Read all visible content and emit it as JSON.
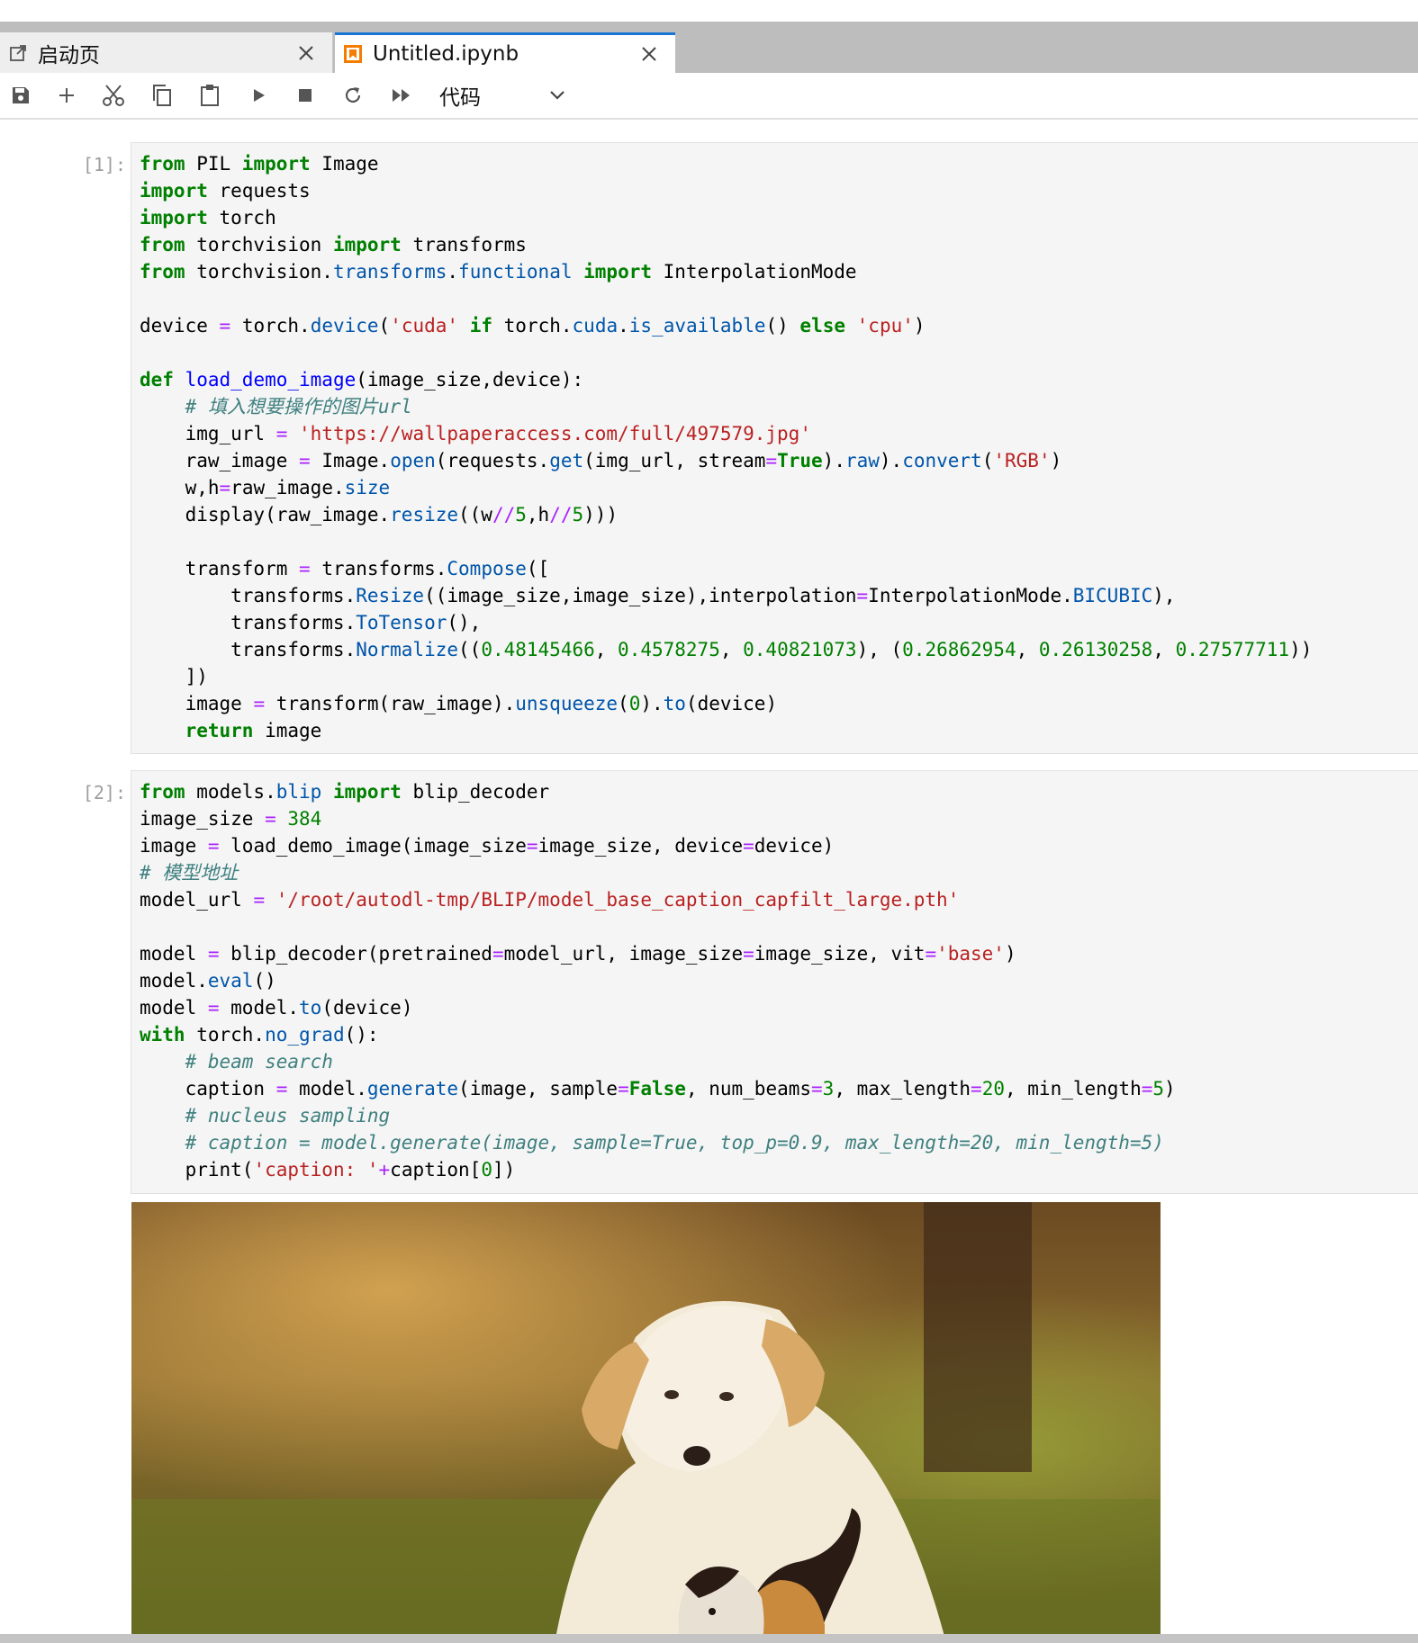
{
  "tabs": [
    {
      "label": "启动页",
      "icon": "launcher-icon",
      "active": false
    },
    {
      "label": "Untitled.ipynb",
      "icon": "notebook-icon",
      "active": true
    }
  ],
  "toolbar": {
    "buttons": [
      "save-icon",
      "add-icon",
      "cut-icon",
      "copy-icon",
      "paste-icon",
      "run-icon",
      "stop-icon",
      "restart-icon",
      "fast-forward-icon"
    ],
    "cell_type": "代码"
  },
  "cells": [
    {
      "prompt": "[1]:",
      "lines": [
        [
          [
            "kw",
            "from"
          ],
          [
            "t",
            " PIL "
          ],
          [
            "kw",
            "import"
          ],
          [
            "t",
            " Image"
          ]
        ],
        [
          [
            "kw",
            "import"
          ],
          [
            "t",
            " requests"
          ]
        ],
        [
          [
            "kw",
            "import"
          ],
          [
            "t",
            " torch"
          ]
        ],
        [
          [
            "kw",
            "from"
          ],
          [
            "t",
            " torchvision "
          ],
          [
            "kw",
            "import"
          ],
          [
            "t",
            " transforms"
          ]
        ],
        [
          [
            "kw",
            "from"
          ],
          [
            "t",
            " torchvision"
          ],
          [
            "t",
            "."
          ],
          [
            "p",
            "transforms"
          ],
          [
            "t",
            "."
          ],
          [
            "p",
            "functional"
          ],
          [
            "t",
            " "
          ],
          [
            "kw",
            "import"
          ],
          [
            "t",
            " InterpolationMode"
          ]
        ],
        [],
        [
          [
            "t",
            "device "
          ],
          [
            "o",
            "="
          ],
          [
            "t",
            " torch."
          ],
          [
            "p",
            "device"
          ],
          [
            "t",
            "("
          ],
          [
            "s",
            "'cuda'"
          ],
          [
            "t",
            " "
          ],
          [
            "kw",
            "if"
          ],
          [
            "t",
            " torch."
          ],
          [
            "p",
            "cuda"
          ],
          [
            "t",
            "."
          ],
          [
            "p",
            "is_available"
          ],
          [
            "t",
            "() "
          ],
          [
            "kw",
            "else"
          ],
          [
            "t",
            " "
          ],
          [
            "s",
            "'cpu'"
          ],
          [
            "t",
            ")"
          ]
        ],
        [],
        [
          [
            "kw",
            "def"
          ],
          [
            "t",
            " "
          ],
          [
            "f",
            "load_demo_image"
          ],
          [
            "t",
            "(image_size,device):"
          ]
        ],
        [
          [
            "t",
            "    "
          ],
          [
            "c",
            "# 填入想要操作的图片url"
          ]
        ],
        [
          [
            "t",
            "    img_url "
          ],
          [
            "o",
            "="
          ],
          [
            "t",
            " "
          ],
          [
            "s",
            "'https://wallpaperaccess.com/full/497579.jpg'"
          ]
        ],
        [
          [
            "t",
            "    raw_image "
          ],
          [
            "o",
            "="
          ],
          [
            "t",
            " Image."
          ],
          [
            "p",
            "open"
          ],
          [
            "t",
            "(requests."
          ],
          [
            "p",
            "get"
          ],
          [
            "t",
            "(img_url, stream"
          ],
          [
            "o",
            "="
          ],
          [
            "kw",
            "True"
          ],
          [
            "t",
            ")."
          ],
          [
            "p",
            "raw"
          ],
          [
            "t",
            ")."
          ],
          [
            "p",
            "convert"
          ],
          [
            "t",
            "("
          ],
          [
            "s",
            "'RGB'"
          ],
          [
            "t",
            ")"
          ]
        ],
        [
          [
            "t",
            "    w,h"
          ],
          [
            "o",
            "="
          ],
          [
            "t",
            "raw_image."
          ],
          [
            "p",
            "size"
          ]
        ],
        [
          [
            "t",
            "    display(raw_image."
          ],
          [
            "p",
            "resize"
          ],
          [
            "t",
            "((w"
          ],
          [
            "o",
            "//"
          ],
          [
            "n",
            "5"
          ],
          [
            "t",
            ",h"
          ],
          [
            "o",
            "//"
          ],
          [
            "n",
            "5"
          ],
          [
            "t",
            ")))"
          ]
        ],
        [],
        [
          [
            "t",
            "    transform "
          ],
          [
            "o",
            "="
          ],
          [
            "t",
            " transforms."
          ],
          [
            "p",
            "Compose"
          ],
          [
            "t",
            "(["
          ]
        ],
        [
          [
            "t",
            "        transforms."
          ],
          [
            "p",
            "Resize"
          ],
          [
            "t",
            "((image_size,image_size),interpolation"
          ],
          [
            "o",
            "="
          ],
          [
            "t",
            "InterpolationMode."
          ],
          [
            "p",
            "BICUBIC"
          ],
          [
            "t",
            "),"
          ]
        ],
        [
          [
            "t",
            "        transforms."
          ],
          [
            "p",
            "ToTensor"
          ],
          [
            "t",
            "(),"
          ]
        ],
        [
          [
            "t",
            "        transforms."
          ],
          [
            "p",
            "Normalize"
          ],
          [
            "t",
            "(("
          ],
          [
            "n",
            "0.48145466"
          ],
          [
            "t",
            ", "
          ],
          [
            "n",
            "0.4578275"
          ],
          [
            "t",
            ", "
          ],
          [
            "n",
            "0.40821073"
          ],
          [
            "t",
            "), ("
          ],
          [
            "n",
            "0.26862954"
          ],
          [
            "t",
            ", "
          ],
          [
            "n",
            "0.26130258"
          ],
          [
            "t",
            ", "
          ],
          [
            "n",
            "0.27577711"
          ],
          [
            "t",
            "))"
          ]
        ],
        [
          [
            "t",
            "    ])"
          ]
        ],
        [
          [
            "t",
            "    image "
          ],
          [
            "o",
            "="
          ],
          [
            "t",
            " transform(raw_image)."
          ],
          [
            "p",
            "unsqueeze"
          ],
          [
            "t",
            "("
          ],
          [
            "n",
            "0"
          ],
          [
            "t",
            ")."
          ],
          [
            "p",
            "to"
          ],
          [
            "t",
            "(device)"
          ]
        ],
        [
          [
            "t",
            "    "
          ],
          [
            "kw",
            "return"
          ],
          [
            "t",
            " image"
          ]
        ]
      ]
    },
    {
      "prompt": "[2]:",
      "lines": [
        [
          [
            "kw",
            "from"
          ],
          [
            "t",
            " models."
          ],
          [
            "p",
            "blip"
          ],
          [
            "t",
            " "
          ],
          [
            "kw",
            "import"
          ],
          [
            "t",
            " blip_decoder"
          ]
        ],
        [
          [
            "t",
            "image_size "
          ],
          [
            "o",
            "="
          ],
          [
            "t",
            " "
          ],
          [
            "n",
            "384"
          ]
        ],
        [
          [
            "t",
            "image "
          ],
          [
            "o",
            "="
          ],
          [
            "t",
            " load_demo_image(image_size"
          ],
          [
            "o",
            "="
          ],
          [
            "t",
            "image_size, device"
          ],
          [
            "o",
            "="
          ],
          [
            "t",
            "device)"
          ]
        ],
        [
          [
            "c",
            "# 模型地址"
          ]
        ],
        [
          [
            "t",
            "model_url "
          ],
          [
            "o",
            "="
          ],
          [
            "t",
            " "
          ],
          [
            "s",
            "'/root/autodl-tmp/BLIP/model_base_caption_capfilt_large.pth'"
          ]
        ],
        [],
        [
          [
            "t",
            "model "
          ],
          [
            "o",
            "="
          ],
          [
            "t",
            " blip_decoder(pretrained"
          ],
          [
            "o",
            "="
          ],
          [
            "t",
            "model_url, image_size"
          ],
          [
            "o",
            "="
          ],
          [
            "t",
            "image_size, vit"
          ],
          [
            "o",
            "="
          ],
          [
            "s",
            "'base'"
          ],
          [
            "t",
            ")"
          ]
        ],
        [
          [
            "t",
            "model."
          ],
          [
            "p",
            "eval"
          ],
          [
            "t",
            "()"
          ]
        ],
        [
          [
            "t",
            "model "
          ],
          [
            "o",
            "="
          ],
          [
            "t",
            " model."
          ],
          [
            "p",
            "to"
          ],
          [
            "t",
            "(device)"
          ]
        ],
        [
          [
            "kw",
            "with"
          ],
          [
            "t",
            " torch."
          ],
          [
            "p",
            "no_grad"
          ],
          [
            "t",
            "():"
          ]
        ],
        [
          [
            "t",
            "    "
          ],
          [
            "c",
            "# beam search"
          ]
        ],
        [
          [
            "t",
            "    caption "
          ],
          [
            "o",
            "="
          ],
          [
            "t",
            " model."
          ],
          [
            "p",
            "generate"
          ],
          [
            "t",
            "(image, sample"
          ],
          [
            "o",
            "="
          ],
          [
            "kw",
            "False"
          ],
          [
            "t",
            ", num_beams"
          ],
          [
            "o",
            "="
          ],
          [
            "n",
            "3"
          ],
          [
            "t",
            ", max_length"
          ],
          [
            "o",
            "="
          ],
          [
            "n",
            "20"
          ],
          [
            "t",
            ", min_length"
          ],
          [
            "o",
            "="
          ],
          [
            "n",
            "5"
          ],
          [
            "t",
            ")"
          ]
        ],
        [
          [
            "t",
            "    "
          ],
          [
            "c",
            "# nucleus sampling"
          ]
        ],
        [
          [
            "t",
            "    "
          ],
          [
            "c",
            "# caption = model.generate(image, sample=True, top_p=0.9, max_length=20, min_length=5)"
          ]
        ],
        [
          [
            "t",
            "    print("
          ],
          [
            "s",
            "'caption: '"
          ],
          [
            "o",
            "+"
          ],
          [
            "t",
            "caption["
          ],
          [
            "n",
            "0"
          ],
          [
            "t",
            "])"
          ]
        ]
      ]
    }
  ],
  "output_image": {
    "subject": "puppy-and-kitten-photo"
  }
}
